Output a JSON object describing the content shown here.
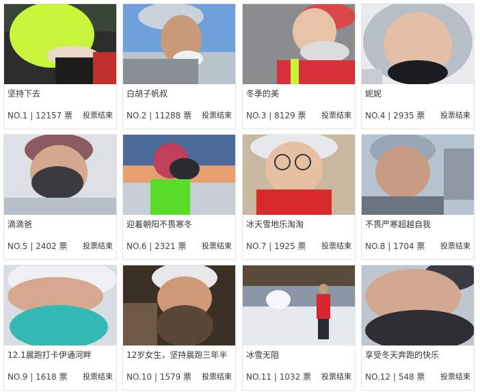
{
  "entries": [
    {
      "title": "坚持下去",
      "no": "NO.1",
      "votes": "12157 票",
      "status": "投票结束"
    },
    {
      "title": "白胡子帆叔",
      "no": "NO.2",
      "votes": "11288 票",
      "status": "投票结束"
    },
    {
      "title": "冬季的美",
      "no": "NO.3",
      "votes": "8129 票",
      "status": "投票结束"
    },
    {
      "title": "妮妮",
      "no": "NO.4",
      "votes": "2935 票",
      "status": "投票结束"
    },
    {
      "title": "滴滴爸",
      "no": "NO.5",
      "votes": "2402 票",
      "status": "投票结束"
    },
    {
      "title": "迎着朝阳不畏寒冬",
      "no": "NO.6",
      "votes": "2321 票",
      "status": "投票结束"
    },
    {
      "title": "冰天雪地乐淘淘",
      "no": "NO.7",
      "votes": "1925 票",
      "status": "投票结束"
    },
    {
      "title": "不畏严寒超越自我",
      "no": "NO.8",
      "votes": "1704 票",
      "status": "投票结束"
    },
    {
      "title": "12.1晨跑打卡伊通河畔",
      "no": "NO.9",
      "votes": "1618 票",
      "status": "投票结束"
    },
    {
      "title": "12岁女生，坚持晨跑三年半",
      "no": "NO.10",
      "votes": "1579 票",
      "status": "投票结束"
    },
    {
      "title": "冰雪无阻",
      "no": "NO.11",
      "votes": "1032 票",
      "status": "投票结束"
    },
    {
      "title": "享受冬天奔跑的快乐",
      "no": "NO.12",
      "votes": "548 票",
      "status": "投票结束"
    }
  ],
  "separator": " | "
}
